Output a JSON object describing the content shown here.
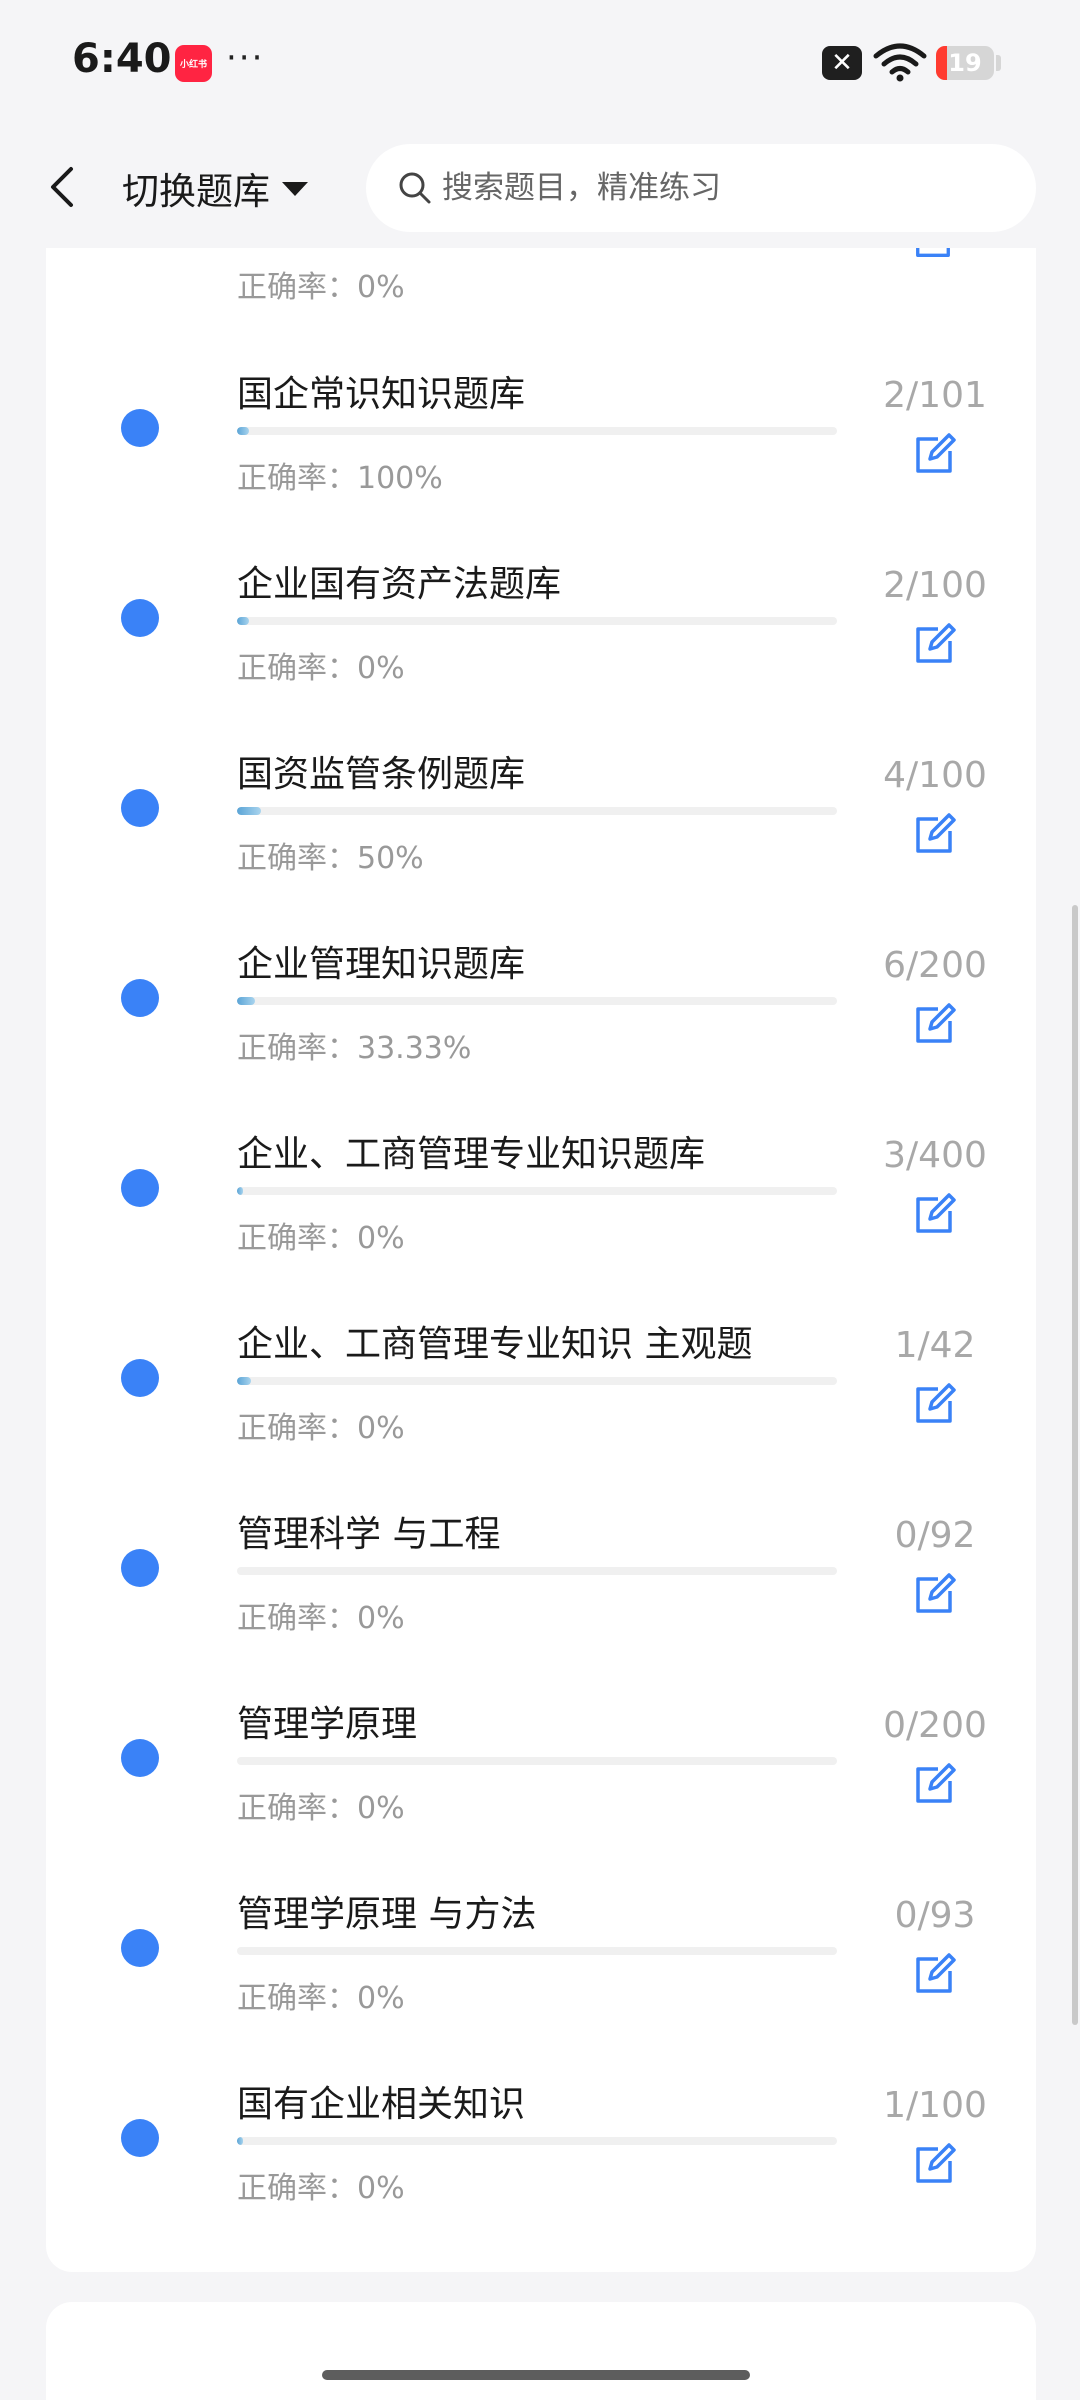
{
  "status_bar": {
    "time": "6:40",
    "app_badge": "小红书",
    "more": "···",
    "battery": "19",
    "battery_level": 0.19
  },
  "header": {
    "switch_label": "切换题库",
    "search_placeholder": "搜索题目，精准练习"
  },
  "list": {
    "partial_accuracy": "正确率：0%",
    "items": [
      {
        "title": "国企常识知识题库",
        "accuracy": "正确率：100%",
        "count": "2/101",
        "progress": 0.0198
      },
      {
        "title": "企业国有资产法题库",
        "accuracy": "正确率：0%",
        "count": "2/100",
        "progress": 0.02
      },
      {
        "title": "国资监管条例题库",
        "accuracy": "正确率：50%",
        "count": "4/100",
        "progress": 0.04
      },
      {
        "title": "企业管理知识题库",
        "accuracy": "正确率：33.33%",
        "count": "6/200",
        "progress": 0.03
      },
      {
        "title": "企业、工商管理专业知识题库",
        "accuracy": "正确率：0%",
        "count": "3/400",
        "progress": 0.0075
      },
      {
        "title": "企业、工商管理专业知识 主观题",
        "accuracy": "正确率：0%",
        "count": "1/42",
        "progress": 0.0238
      },
      {
        "title": "管理科学 与工程",
        "accuracy": "正确率：0%",
        "count": "0/92",
        "progress": 0
      },
      {
        "title": "管理学原理",
        "accuracy": "正确率：0%",
        "count": "0/200",
        "progress": 0
      },
      {
        "title": "管理学原理 与方法",
        "accuracy": "正确率：0%",
        "count": "0/93",
        "progress": 0
      },
      {
        "title": "国有企业相关知识",
        "accuracy": "正确率：0%",
        "count": "1/100",
        "progress": 0.01
      }
    ]
  },
  "colors": {
    "accent_dot": "#3a82f7",
    "edit_icon": "#3a82f7",
    "progress": "#5aa4d6"
  }
}
